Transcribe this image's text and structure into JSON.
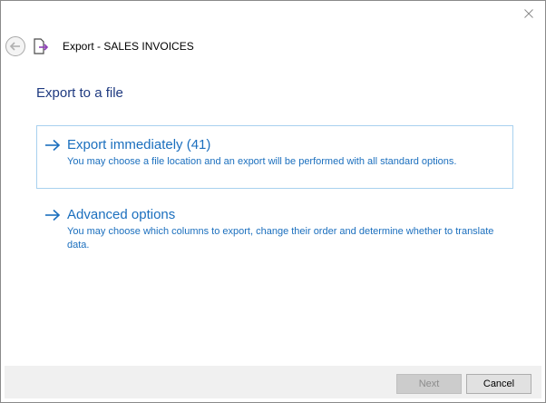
{
  "window": {
    "title": "Export - SALES INVOICES"
  },
  "icons": {
    "close": "close-icon",
    "back": "back-arrow-icon",
    "export": "export-document-icon",
    "option_arrow": "right-arrow-icon"
  },
  "section": {
    "title": "Export to a file"
  },
  "options": [
    {
      "title": "Export immediately (41)",
      "description": "You may choose a file location and an export will be performed with all standard options.",
      "selected": true
    },
    {
      "title": "Advanced options",
      "description": "You may choose which columns to export, change their order and determine whether to translate data.",
      "selected": false
    }
  ],
  "footer": {
    "next_label": "Next",
    "next_enabled": false,
    "cancel_label": "Cancel"
  },
  "colors": {
    "accent": "#1b6fbe",
    "section_title": "#1f3a80",
    "selection_border": "#a8d1ef",
    "export_icon_arrow": "#8e3fb8"
  }
}
